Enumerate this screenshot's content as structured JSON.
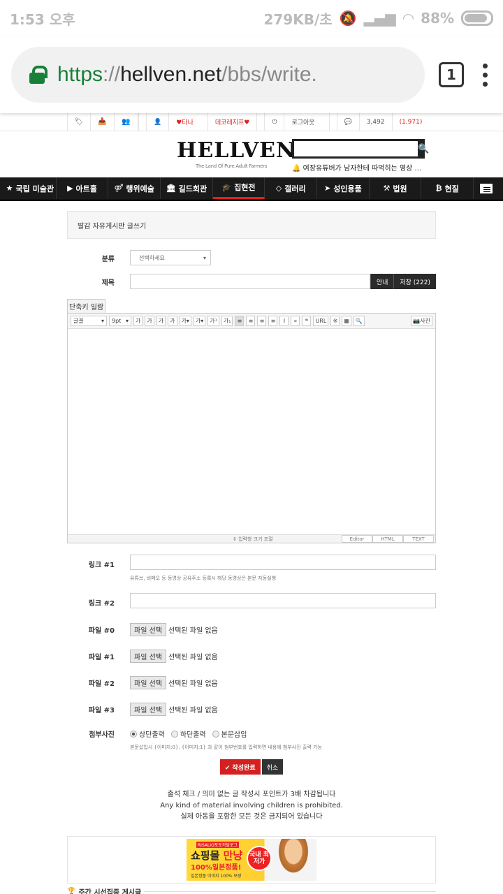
{
  "status": {
    "time": "1:53 오후",
    "net": "279KB/초",
    "battery": "88%"
  },
  "browser": {
    "scheme": "https",
    "sep": "://",
    "host": "hellven.net",
    "path": "/bbs/write.",
    "tabs": "1"
  },
  "topline": {
    "user": "♥타나",
    "deco": "데코레지프♥",
    "logout": "로그아웃",
    "points": "3,492",
    "points_extra": "(1,971)"
  },
  "header": {
    "logo": "HELLVEN",
    "tagline": "The Land Of Pure Adult Farmers",
    "notice": "여장유튜버가 남자한테 따먹히는 영상 …"
  },
  "nav": [
    {
      "icon": "★",
      "label": "국립 미술관"
    },
    {
      "icon": "▶",
      "label": "아트홀"
    },
    {
      "icon": "⚤",
      "label": "행위예술"
    },
    {
      "icon": "🏛",
      "label": "길드회관"
    },
    {
      "icon": "🎓",
      "label": "집현전"
    },
    {
      "icon": "◇",
      "label": "갤러리"
    },
    {
      "icon": "➤",
      "label": "성인용품"
    },
    {
      "icon": "⚒",
      "label": "법원"
    },
    {
      "icon": "₿",
      "label": "현질"
    }
  ],
  "form": {
    "board_title": "딸감 자유게시판 글쓰기",
    "category_label": "분류",
    "category_value": "선택하세요",
    "subject_label": "제목",
    "guide_btn": "안내",
    "save_btn": "저장 (222)",
    "shortcut": "단축키 일람",
    "toolbar": {
      "font": "글꼴",
      "size": "9pt",
      "photo": "사진"
    },
    "resize_label": "입력창 크기 조절",
    "modes": [
      "Editor",
      "HTML",
      "TEXT"
    ],
    "link1_label": "링크 #1",
    "link1_help": "유튜브, 비메오 등 동영상 공유주소 등록시 해당 동영상은 본문 자동실행",
    "link2_label": "링크 #2",
    "files": [
      {
        "label": "파일 #0",
        "button": "파일 선택",
        "status": "선택된 파일 없음"
      },
      {
        "label": "파일 #1",
        "button": "파일 선택",
        "status": "선택된 파일 없음"
      },
      {
        "label": "파일 #2",
        "button": "파일 선택",
        "status": "선택된 파일 없음"
      },
      {
        "label": "파일 #3",
        "button": "파일 선택",
        "status": "선택된 파일 없음"
      }
    ],
    "attach_label": "첨부사진",
    "attach_options": [
      "상단출력",
      "하단출력",
      "본문삽입"
    ],
    "attach_help": "본문삽입시 {이미지:0}, {이미지:1} 과 같이 첨부번호를 입력하면 내용에 첨부사진 출력 가능",
    "submit": "✔ 작성완료",
    "cancel": "취소"
  },
  "notes": [
    "출석 체크 / 의미 없는 글 작성시 포인트가 3배 차감됩니다",
    "Any kind of material involving children is prohibited.",
    "실제 아동을 포함한 모든 것은 금지되어 있습니다"
  ],
  "ad": {
    "l1": "RISALIO포토카탈로그",
    "l2a": "쇼핑몰 ",
    "l2b": "만냥",
    "l3": "100%일본정품!",
    "l4": "일본정품 이미지 100% 보장",
    "badge": "국내 최저가"
  },
  "weekly": "주간 시선집중 게시글"
}
